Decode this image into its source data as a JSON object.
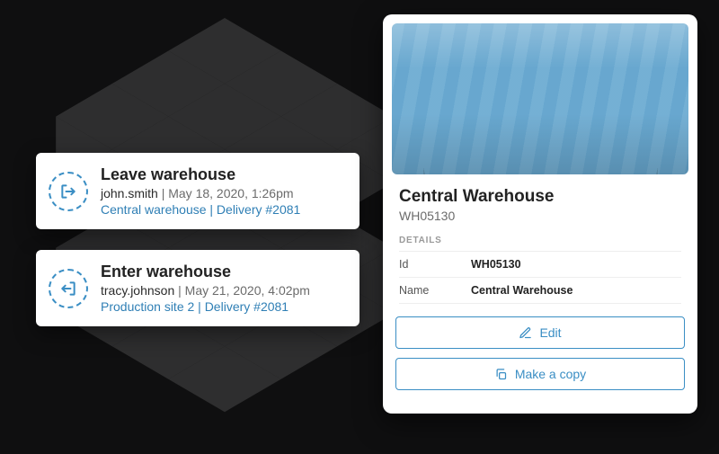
{
  "activities": [
    {
      "title": "Leave warehouse",
      "user": "john.smith",
      "timestamp": "May 18, 2020, 1:26pm",
      "context": "Central warehouse | Delivery #2081",
      "icon": "leave"
    },
    {
      "title": "Enter warehouse",
      "user": "tracy.johnson",
      "timestamp": "May 21, 2020, 4:02pm",
      "context": "Production site 2 | Delivery #2081",
      "icon": "enter"
    }
  ],
  "detail": {
    "title": "Central Warehouse",
    "subtitle": "WH05130",
    "section_label": "DETAILS",
    "fields": {
      "id": {
        "label": "Id",
        "value": "WH05130"
      },
      "name": {
        "label": "Name",
        "value": "Central Warehouse"
      }
    },
    "actions": {
      "edit": "Edit",
      "copy": "Make a copy"
    }
  }
}
